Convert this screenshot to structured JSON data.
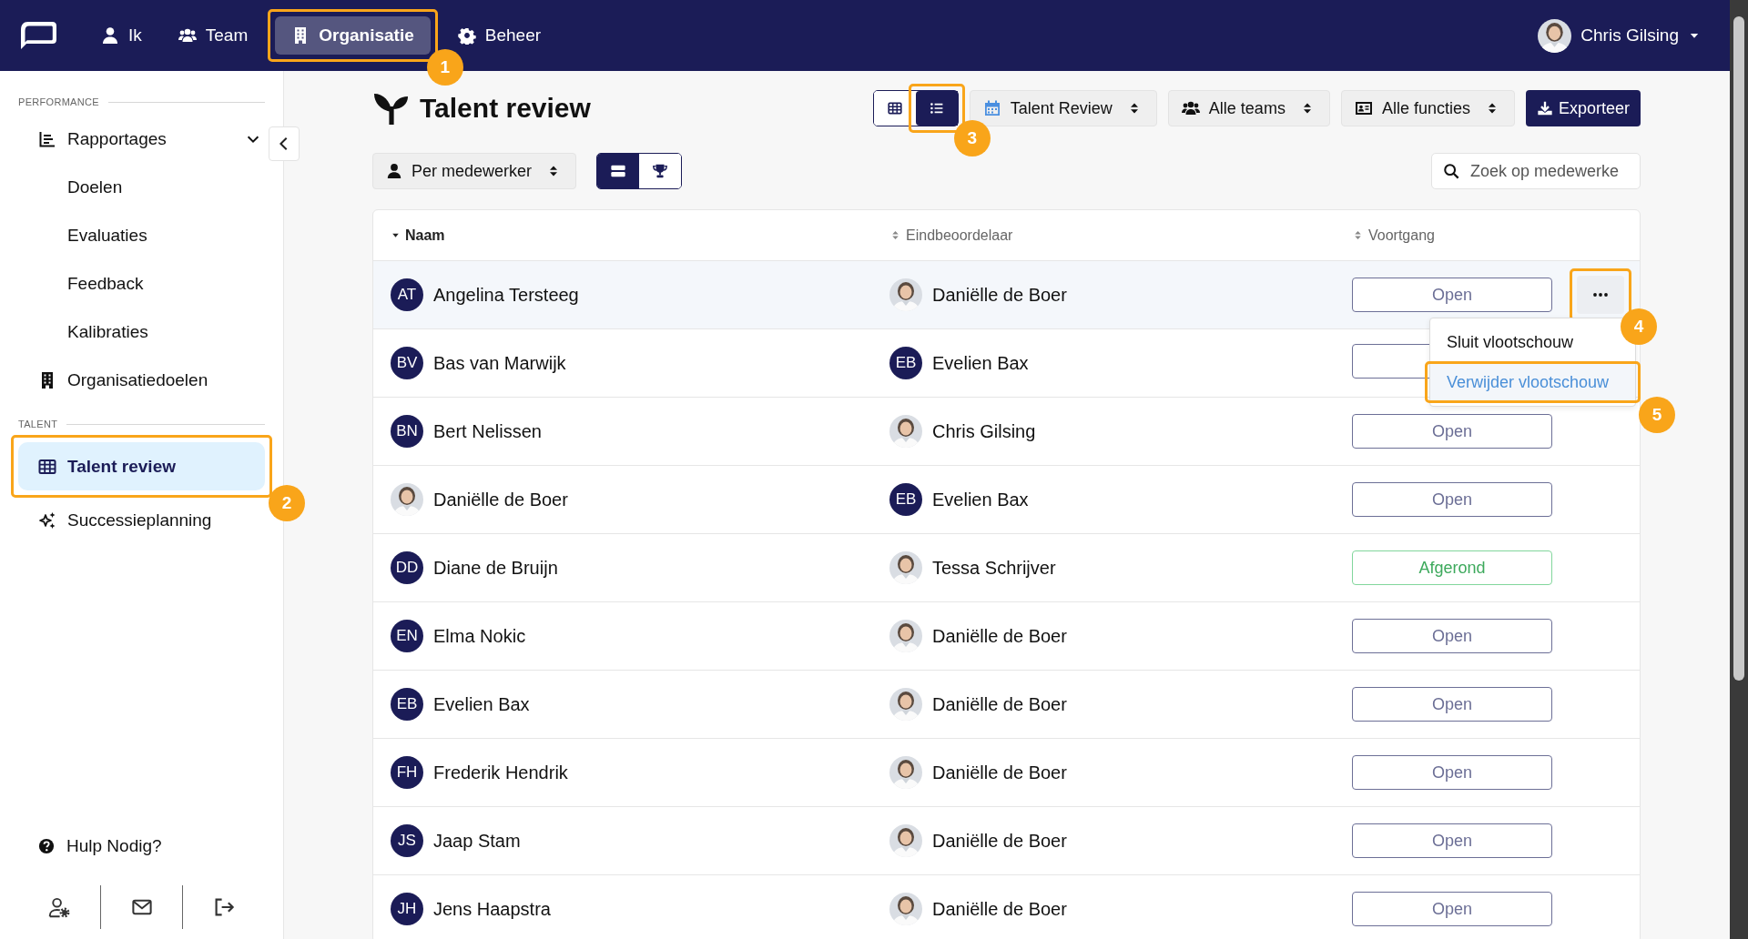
{
  "nav": {
    "items": [
      {
        "label": "Ik",
        "selected": false
      },
      {
        "label": "Team",
        "selected": false
      },
      {
        "label": "Organisatie",
        "selected": true,
        "callout": "1"
      },
      {
        "label": "Beheer",
        "selected": false
      }
    ],
    "user": {
      "name": "Chris Gilsing"
    }
  },
  "sidebar": {
    "sections": [
      {
        "label": "PERFORMANCE",
        "items": [
          {
            "label": "Rapportages",
            "expanded": true,
            "selected": false,
            "children": [
              {
                "label": "Doelen",
                "selected": false
              },
              {
                "label": "Evaluaties",
                "selected": false
              },
              {
                "label": "Feedback",
                "selected": false
              },
              {
                "label": "Kalibraties",
                "selected": false
              }
            ]
          },
          {
            "label": "Organisatiedoelen",
            "selected": false
          }
        ]
      },
      {
        "label": "TALENT",
        "items": [
          {
            "label": "Talent review",
            "selected": true,
            "callout": "2"
          },
          {
            "label": "Successieplanning",
            "selected": false
          }
        ]
      }
    ],
    "help": "Hulp Nodig?"
  },
  "page": {
    "title": "Talent review",
    "view_toggle": [
      {
        "selected": false
      },
      {
        "selected": true,
        "callout": "3"
      }
    ],
    "filters": [
      {
        "label": "Talent Review"
      },
      {
        "label": "Alle teams"
      },
      {
        "label": "Alle functies"
      }
    ],
    "export": "Exporteer",
    "group_by": {
      "label": "Per medewerker"
    },
    "mode_toggle": [
      {
        "selected": true
      },
      {
        "selected": false
      }
    ],
    "search": {
      "placeholder": "Zoek op medewerke"
    }
  },
  "table": {
    "columns": [
      {
        "label": "Naam",
        "sorted": true
      },
      {
        "label": "Eindbeoordelaar",
        "sorted": false
      },
      {
        "label": "Voortgang",
        "sorted": false
      }
    ],
    "rows": [
      {
        "name": "Angelina Tersteeg",
        "avatar": {
          "kind": "initials",
          "text": "AT"
        },
        "reviewer": "Daniëlle de Boer",
        "progress": {
          "kind": "open",
          "label": "Open"
        },
        "actions": {
          "open": true,
          "callout": "4",
          "menu": [
            {
              "label": "Sluit vlootschouw",
              "selected": false
            },
            {
              "label": "Verwijder vlootschouw",
              "selected": true,
              "callout": "5"
            }
          ]
        }
      },
      {
        "name": "Bas van Marwijk",
        "avatar": {
          "kind": "initials",
          "text": "BV"
        },
        "reviewer": "Evelien Bax",
        "reviewer_avatar": {
          "kind": "initials",
          "text": "EB"
        },
        "progress": {
          "kind": "open"
        }
      },
      {
        "name": "Bert Nelissen",
        "avatar": {
          "kind": "initials",
          "text": "BN"
        },
        "reviewer": "Chris Gilsing",
        "progress": {
          "kind": "open",
          "label": "Open"
        }
      },
      {
        "name": "Daniëlle de Boer",
        "reviewer": "Evelien Bax",
        "reviewer_avatar": {
          "kind": "initials",
          "text": "EB"
        },
        "progress": {
          "kind": "open",
          "label": "Open"
        }
      },
      {
        "name": "Diane de Bruijn",
        "avatar": {
          "kind": "initials",
          "text": "DD"
        },
        "reviewer": "Tessa Schrijver",
        "progress": {
          "kind": "done",
          "label": "Afgerond"
        }
      },
      {
        "name": "Elma Nokic",
        "avatar": {
          "kind": "initials",
          "text": "EN"
        },
        "reviewer": "Daniëlle de Boer",
        "progress": {
          "kind": "open",
          "label": "Open"
        }
      },
      {
        "name": "Evelien Bax",
        "avatar": {
          "kind": "initials",
          "text": "EB"
        },
        "reviewer": "Daniëlle de Boer",
        "progress": {
          "kind": "open",
          "label": "Open"
        }
      },
      {
        "name": "Frederik Hendrik",
        "avatar": {
          "kind": "initials",
          "text": "FH"
        },
        "reviewer": "Daniëlle de Boer",
        "progress": {
          "kind": "open",
          "label": "Open"
        }
      },
      {
        "name": "Jaap Stam",
        "avatar": {
          "kind": "initials",
          "text": "JS"
        },
        "reviewer": "Daniëlle de Boer",
        "progress": {
          "kind": "open",
          "label": "Open"
        }
      },
      {
        "name": "Jens Haapstra",
        "avatar": {
          "kind": "initials",
          "text": "JH"
        },
        "reviewer": "Daniëlle de Boer",
        "progress": {
          "kind": "open",
          "label": "Open"
        }
      }
    ]
  }
}
